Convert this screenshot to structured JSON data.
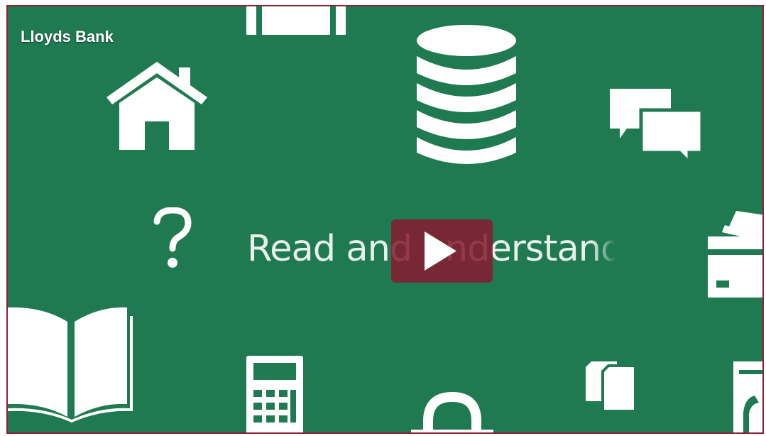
{
  "video": {
    "channel_title": "Lloyds Bank",
    "caption": "Read and understand"
  },
  "icons": [
    "briefcase-icon",
    "coin-stack-icon",
    "house-icon",
    "speech-bubbles-icon",
    "question-mark-icon",
    "credit-card-icon",
    "open-book-icon",
    "calculator-icon",
    "padlock-icon",
    "documents-icon",
    "clipboard-icon",
    "play-icon"
  ],
  "colors": {
    "background": "#1f7a52",
    "frame_border": "#8a2238",
    "play_button": "#861b30",
    "icon": "#ffffff"
  }
}
